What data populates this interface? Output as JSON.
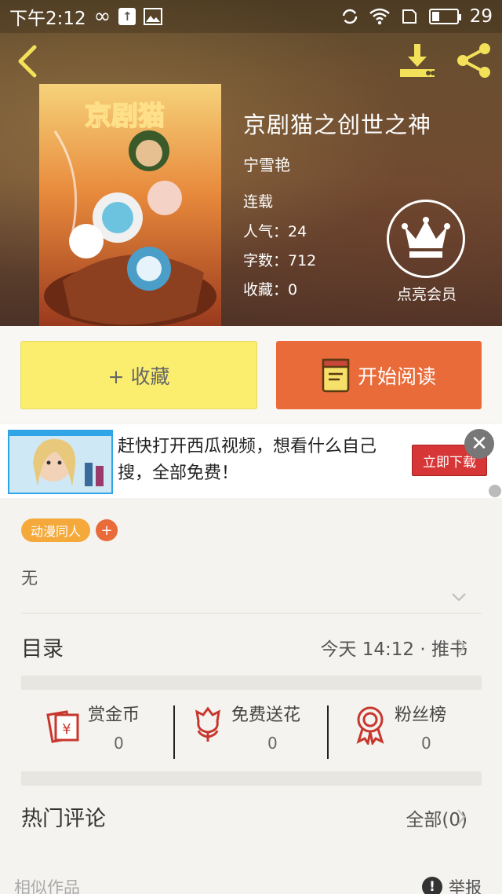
{
  "status_bar": {
    "time": "下午2:12",
    "battery": "29"
  },
  "book": {
    "title": "京剧猫之创世之神",
    "author": "宁雪艳",
    "status": "连载",
    "popularity": "人气：24",
    "word_count": "字数：712",
    "favorites": "收藏：0",
    "cover_title": "京剧猫"
  },
  "vip": {
    "label": "点亮会员"
  },
  "actions": {
    "favorite_label": "+ 收藏",
    "read_label": "开始阅读"
  },
  "ad": {
    "text": "赶快打开西瓜视频，想看什么自己搜，全部免费！",
    "cta": "立即下载"
  },
  "tags": [
    "动漫同人"
  ],
  "description": "无",
  "toc": {
    "title": "目录",
    "meta": "今天 14:12 · 推书"
  },
  "stats": [
    {
      "label": "赏金币",
      "value": "0"
    },
    {
      "label": "免费送花",
      "value": "0"
    },
    {
      "label": "粉丝榜",
      "value": "0"
    }
  ],
  "comments": {
    "title": "热门评论",
    "all": "全部(0)"
  },
  "footer": {
    "similar": "相似作品",
    "report": "举报"
  },
  "colors": {
    "accent": "#e96b3a",
    "favorite_btn": "#fbee6e",
    "tag": "#f4a93a"
  }
}
